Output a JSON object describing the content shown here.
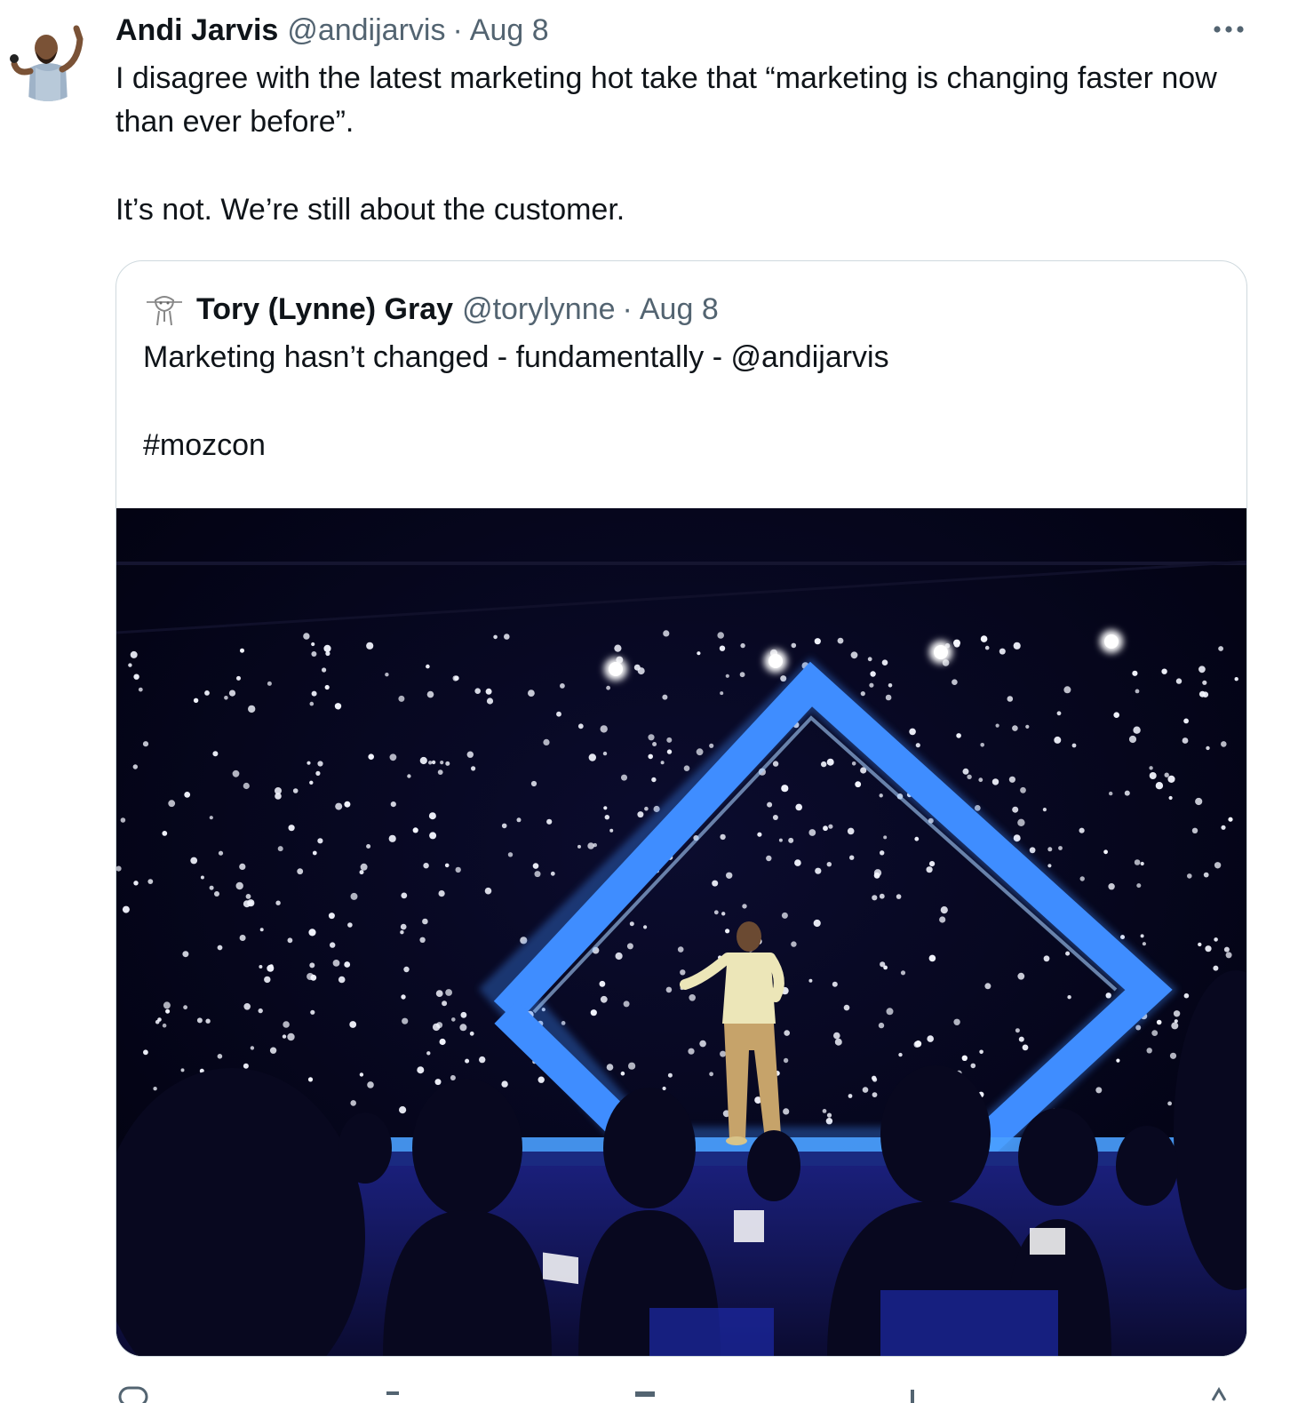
{
  "tweet": {
    "author_name": "Andi Jarvis",
    "author_handle": "@andijarvis",
    "separator": "·",
    "date": "Aug 8",
    "text_line1": "I disagree with the latest marketing hot take that “marketing is changing faster now than ever before”.",
    "text_line2": "It’s not. We’re still about the customer."
  },
  "quoted": {
    "author_name": "Tory (Lynne) Gray",
    "author_handle": "@torylynne",
    "separator": "·",
    "date": "Aug 8",
    "text_line1": "Marketing hasn’t changed - fundamentally - @andijarvis",
    "hashtag": "#mozcon"
  },
  "icons": {
    "more": "more-horizontal-icon"
  },
  "colors": {
    "text": "#0f1419",
    "secondary": "#536471",
    "border": "#cfd9de",
    "stage_blue": "#3d8bff"
  }
}
